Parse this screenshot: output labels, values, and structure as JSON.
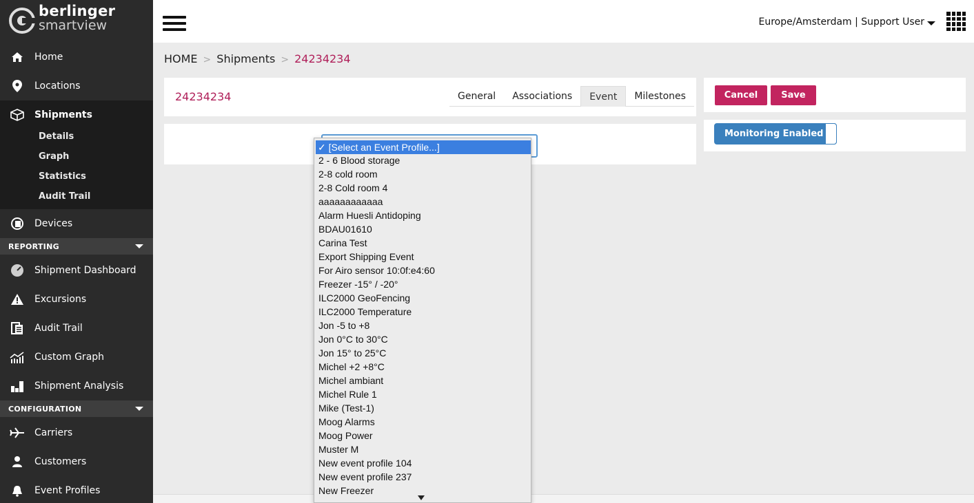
{
  "brand": {
    "line1": "berlinger",
    "line2": "smartview"
  },
  "sidebar": {
    "items": [
      {
        "label": "Home",
        "icon": "home-icon"
      },
      {
        "label": "Locations",
        "icon": "map-pin-icon"
      },
      {
        "label": "Shipments",
        "icon": "box-icon",
        "active": true
      },
      {
        "label": "Devices",
        "icon": "device-icon"
      },
      {
        "label": "Shipment Dashboard",
        "icon": "dashboard-icon"
      },
      {
        "label": "Excursions",
        "icon": "warning-icon"
      },
      {
        "label": "Audit Trail",
        "icon": "clipboard-icon"
      },
      {
        "label": "Custom Graph",
        "icon": "graph-icon"
      },
      {
        "label": "Shipment Analysis",
        "icon": "bar-chart-icon"
      },
      {
        "label": "Carriers",
        "icon": "plane-icon"
      },
      {
        "label": "Customers",
        "icon": "user-icon"
      },
      {
        "label": "Event Profiles",
        "icon": "bell-icon"
      }
    ],
    "subitems": [
      "Details",
      "Graph",
      "Statistics",
      "Audit Trail"
    ],
    "sections": [
      "REPORTING",
      "CONFIGURATION"
    ]
  },
  "topbar": {
    "user": "Europe/Amsterdam | Support User"
  },
  "breadcrumb": {
    "home": "HOME",
    "shipments": "Shipments",
    "current": "24234234"
  },
  "shipment": {
    "id": "24234234",
    "tabs": [
      "General",
      "Associations",
      "Event",
      "Milestones"
    ],
    "active_tab": "Event"
  },
  "actions": {
    "cancel": "Cancel",
    "save": "Save",
    "monitoring": "Monitoring Enabled"
  },
  "dropdown": {
    "selected": "✓ [Select an Event Profile...]",
    "options": [
      "2 - 6 Blood storage",
      "2-8 cold room",
      "2-8 Cold room 4",
      "aaaaaaaaaaaa",
      "Alarm Huesli Antidoping",
      "BDAU01610",
      "Carina Test",
      "Export Shipping Event",
      "For Airo sensor 10:0f:e4:60",
      "Freezer -15° / -20°",
      "ILC2000 GeoFencing",
      "ILC2000 Temperature",
      "Jon -5 to +8",
      "Jon 0°C to 30°C",
      "Jon 15° to 25°C",
      "Michel +2 +8°C",
      "Michel ambiant",
      "Michel Rule 1",
      "Mike (Test-1)",
      "Moog Alarms",
      "Moog Power",
      "Muster M",
      "New event profile 104",
      "New event profile 237",
      "New Freezer"
    ]
  },
  "colors": {
    "accent": "#c2245f",
    "brand_text": "#b0205a",
    "toggle": "#3a80bd",
    "sidebar": "#2b2b2b"
  }
}
